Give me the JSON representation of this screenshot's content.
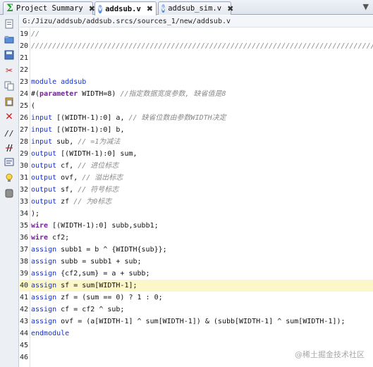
{
  "tabs": [
    {
      "label": "Project Summary",
      "icon": "sigma-icon",
      "active": false
    },
    {
      "label": "addsub.v",
      "icon": "verilog-file-icon",
      "active": true
    },
    {
      "label": "addsub_sim.v",
      "icon": "verilog-file-icon",
      "active": false
    }
  ],
  "tab_close_glyph": "✖",
  "tab_menu_glyph": "▼",
  "file_path": "G:/Jizu/addsub/addsub.srcs/sources_1/new/addsub.v",
  "toolbar_icons": [
    "new-file-icon",
    "open-icon",
    "save-icon",
    "cut-icon",
    "copy-icon",
    "paste-icon",
    "delete-icon",
    "comment-icon",
    "uncomment-icon",
    "format-icon",
    "hint-icon",
    "insert-template-icon"
  ],
  "highlighted_line": 40,
  "lines": [
    {
      "n": "19",
      "segs": [
        {
          "t": "//",
          "c": "cm"
        }
      ]
    },
    {
      "n": "20",
      "segs": [
        {
          "t": "//////////////////////////////////////////////////////////////////////////////////",
          "c": "cm"
        }
      ]
    },
    {
      "n": "21",
      "segs": []
    },
    {
      "n": "22",
      "segs": []
    },
    {
      "n": "23",
      "segs": [
        {
          "t": "module addsub",
          "c": "kw"
        }
      ]
    },
    {
      "n": "24",
      "segs": [
        {
          "t": "#(",
          "c": ""
        },
        {
          "t": "parameter",
          "c": "kwb"
        },
        {
          "t": " WIDTH=8) ",
          "c": ""
        },
        {
          "t": "//指定数据宽度参数, 缺省值是8",
          "c": "cm"
        }
      ]
    },
    {
      "n": "25",
      "segs": [
        {
          "t": "(",
          "c": ""
        }
      ]
    },
    {
      "n": "26",
      "segs": [
        {
          "t": "input",
          "c": "kw"
        },
        {
          "t": " [(WIDTH-1):0] a, ",
          "c": ""
        },
        {
          "t": "// 缺省位数由参数WIDTH决定",
          "c": "cm"
        }
      ]
    },
    {
      "n": "27",
      "segs": [
        {
          "t": "input",
          "c": "kw"
        },
        {
          "t": " [(WIDTH-1):0] b,",
          "c": ""
        }
      ]
    },
    {
      "n": "28",
      "segs": [
        {
          "t": "input",
          "c": "kw"
        },
        {
          "t": " sub, ",
          "c": ""
        },
        {
          "t": "// =1为减法",
          "c": "cm"
        }
      ]
    },
    {
      "n": "29",
      "segs": [
        {
          "t": "output",
          "c": "kw"
        },
        {
          "t": " [(WIDTH-1):0] sum,",
          "c": ""
        }
      ]
    },
    {
      "n": "30",
      "segs": [
        {
          "t": "output",
          "c": "kw"
        },
        {
          "t": " cf, ",
          "c": ""
        },
        {
          "t": "// 进位标志",
          "c": "cm"
        }
      ]
    },
    {
      "n": "31",
      "segs": [
        {
          "t": "output",
          "c": "kw"
        },
        {
          "t": " ovf, ",
          "c": ""
        },
        {
          "t": "// 溢出标志",
          "c": "cm"
        }
      ]
    },
    {
      "n": "32",
      "segs": [
        {
          "t": "output",
          "c": "kw"
        },
        {
          "t": " sf, ",
          "c": ""
        },
        {
          "t": "// 符号标志",
          "c": "cm"
        }
      ]
    },
    {
      "n": "33",
      "segs": [
        {
          "t": "output",
          "c": "kw"
        },
        {
          "t": " zf ",
          "c": ""
        },
        {
          "t": "// 为0标志",
          "c": "cm"
        }
      ]
    },
    {
      "n": "34",
      "segs": [
        {
          "t": ");",
          "c": ""
        }
      ]
    },
    {
      "n": "35",
      "segs": [
        {
          "t": "wire",
          "c": "kwb"
        },
        {
          "t": " [(WIDTH-1):0] subb,subb1;",
          "c": ""
        }
      ]
    },
    {
      "n": "36",
      "segs": [
        {
          "t": "wire",
          "c": "kwb"
        },
        {
          "t": " cf2;",
          "c": ""
        }
      ]
    },
    {
      "n": "37",
      "segs": [
        {
          "t": "assign",
          "c": "kw"
        },
        {
          "t": " subb1 = b ^ {WIDTH{sub}};",
          "c": ""
        }
      ]
    },
    {
      "n": "38",
      "segs": [
        {
          "t": "assign",
          "c": "kw"
        },
        {
          "t": " subb = subb1 + sub;",
          "c": ""
        }
      ]
    },
    {
      "n": "39",
      "segs": [
        {
          "t": "assign",
          "c": "kw"
        },
        {
          "t": " {cf2,sum} = a + subb;",
          "c": ""
        }
      ]
    },
    {
      "n": "40",
      "segs": [
        {
          "t": "assign",
          "c": "kw"
        },
        {
          "t": " sf = sum[WIDTH-1];",
          "c": ""
        }
      ]
    },
    {
      "n": "41",
      "segs": [
        {
          "t": "assign",
          "c": "kw"
        },
        {
          "t": " zf = (sum == 0) ? 1 : 0;",
          "c": ""
        }
      ]
    },
    {
      "n": "42",
      "segs": [
        {
          "t": "assign",
          "c": "kw"
        },
        {
          "t": " cf = cf2 ^ sub;",
          "c": ""
        }
      ]
    },
    {
      "n": "43",
      "segs": [
        {
          "t": "assign",
          "c": "kw"
        },
        {
          "t": " ovf = (a[WIDTH-1] ^ sum[WIDTH-1]) & (subb[WIDTH-1] ^ sum[WIDTH-1]);",
          "c": ""
        }
      ]
    },
    {
      "n": "44",
      "segs": [
        {
          "t": "endmodule",
          "c": "kw"
        }
      ]
    },
    {
      "n": "45",
      "segs": []
    },
    {
      "n": "46",
      "segs": []
    }
  ],
  "watermark": "@稀土掘金技术社区"
}
